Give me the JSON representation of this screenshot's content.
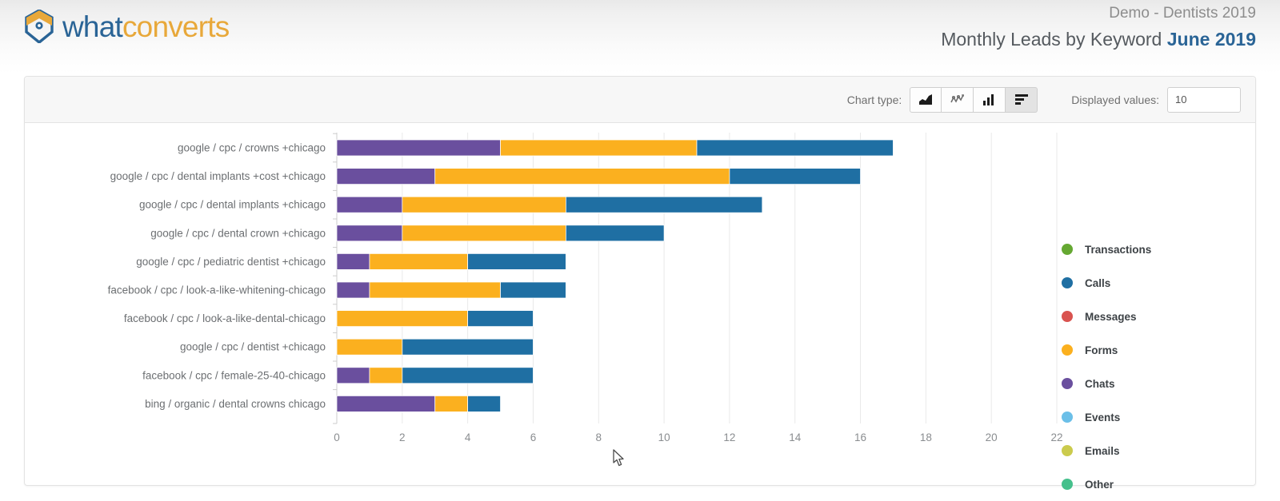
{
  "header": {
    "logo_text_part1": "what",
    "logo_text_part2": "converts",
    "logo_icon": "whatconverts-hex-logo-icon",
    "account_name": "Demo - Dentists 2019",
    "report_title": "Monthly Leads by Keyword",
    "report_period": "June 2019"
  },
  "toolbar": {
    "chart_type_label": "Chart type:",
    "chart_types": [
      {
        "name": "area-chart-icon",
        "label": "Area chart",
        "active": false
      },
      {
        "name": "line-chart-icon",
        "label": "Line chart",
        "active": false
      },
      {
        "name": "column-chart-icon",
        "label": "Column chart",
        "active": false
      },
      {
        "name": "horizontal-bar-chart-icon",
        "label": "Horizontal bar chart",
        "active": true
      }
    ],
    "displayed_values_label": "Displayed values:",
    "displayed_values": "10",
    "displayed_values_placeholder": "10"
  },
  "legend": {
    "items": [
      {
        "label": "Transactions",
        "color": "#65a832"
      },
      {
        "label": "Calls",
        "color": "#1f6fa3"
      },
      {
        "label": "Messages",
        "color": "#d9534f"
      },
      {
        "label": "Forms",
        "color": "#fbb01f"
      },
      {
        "label": "Chats",
        "color": "#6a4f9e"
      },
      {
        "label": "Events",
        "color": "#6bbfe8"
      },
      {
        "label": "Emails",
        "color": "#cbcb4d"
      },
      {
        "label": "Other",
        "color": "#45c08c"
      }
    ]
  },
  "chart_data": {
    "type": "bar",
    "orientation": "horizontal",
    "stacked": true,
    "title": "Monthly Leads by Keyword",
    "xlabel": "",
    "ylabel": "",
    "xlim": [
      0,
      22
    ],
    "xticks": [
      0,
      2,
      4,
      6,
      8,
      10,
      12,
      14,
      16,
      18,
      20,
      22
    ],
    "grid": true,
    "legend_position": "right",
    "categories": [
      "google / cpc / crowns +chicago",
      "google / cpc / dental implants +cost +chicago",
      "google / cpc / dental implants +chicago",
      "google / cpc / dental crown +chicago",
      "google / cpc / pediatric dentist +chicago",
      "facebook / cpc / look-a-like-whitening-chicago",
      "facebook / cpc / look-a-like-dental-chicago",
      "google / cpc / dentist +chicago",
      "facebook / cpc / female-25-40-chicago",
      "bing / organic / dental crowns chicago"
    ],
    "series": [
      {
        "name": "Transactions",
        "color": "#65a832",
        "values": [
          0,
          0,
          0,
          0,
          0,
          0,
          0,
          0,
          0,
          0
        ]
      },
      {
        "name": "Calls",
        "color": "#1f6fa3",
        "values": [
          6,
          4,
          6,
          3,
          3,
          2,
          2,
          4,
          4,
          1
        ]
      },
      {
        "name": "Messages",
        "color": "#d9534f",
        "values": [
          0,
          0,
          0,
          0,
          0,
          0,
          0,
          0,
          0,
          0
        ]
      },
      {
        "name": "Forms",
        "color": "#fbb01f",
        "values": [
          6,
          9,
          5,
          5,
          3,
          4,
          4,
          2,
          1,
          1
        ]
      },
      {
        "name": "Chats",
        "color": "#6a4f9e",
        "values": [
          5,
          3,
          2,
          2,
          1,
          1,
          0,
          0,
          1,
          3
        ]
      },
      {
        "name": "Events",
        "color": "#6bbfe8",
        "values": [
          0,
          0,
          0,
          0,
          0,
          0,
          0,
          0,
          0,
          0
        ]
      },
      {
        "name": "Emails",
        "color": "#cbcb4d",
        "values": [
          0,
          0,
          0,
          0,
          0,
          0,
          0,
          0,
          0,
          0
        ]
      },
      {
        "name": "Other",
        "color": "#45c08c",
        "values": [
          0,
          0,
          0,
          0,
          0,
          0,
          0,
          0,
          0,
          0
        ]
      }
    ],
    "stack_order": [
      "Chats",
      "Forms",
      "Calls"
    ],
    "totals": [
      17,
      16,
      13,
      10,
      7,
      7,
      6,
      6,
      6,
      5
    ]
  }
}
